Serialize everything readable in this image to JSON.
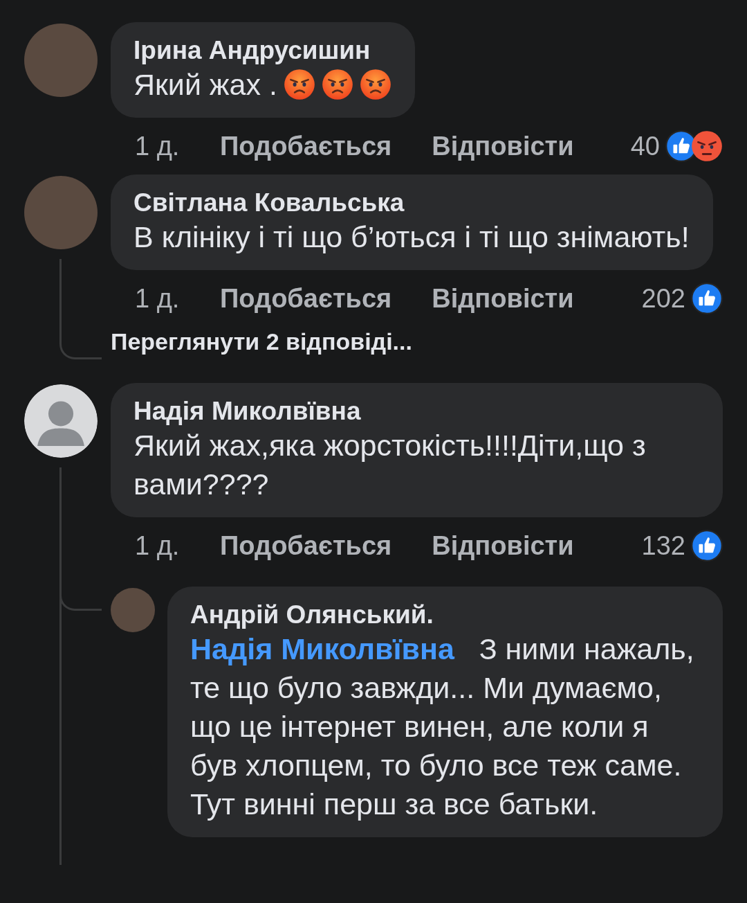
{
  "comments": [
    {
      "author": "Ірина Андрусишин",
      "avatar": {
        "kind": "photo"
      },
      "text": "Який жах .",
      "emoji": [
        {
          "kind": "angry"
        },
        {
          "kind": "angry"
        },
        {
          "kind": "angry"
        }
      ],
      "time": "1 д.",
      "like_label": "Подобається",
      "reply_label": "Відповісти",
      "reaction_count": "40",
      "reactions": [
        {
          "kind": "like"
        },
        {
          "kind": "angry"
        }
      ]
    },
    {
      "author": "Світлана Ковальська",
      "avatar": {
        "kind": "photo"
      },
      "text": "В клініку і ті що б’ються і ті що знімають!",
      "time": "1 д.",
      "like_label": "Подобається",
      "reply_label": "Відповісти",
      "reaction_count": "202",
      "reactions": [
        {
          "kind": "like"
        }
      ],
      "view_replies": "Переглянути 2 відповіді..."
    },
    {
      "author": "Надія Миколвївна",
      "avatar": {
        "kind": "default"
      },
      "text": "Який жах,яка жорстокість!!!!Діти,що з вами????",
      "time": "1 д.",
      "like_label": "Подобається",
      "reply_label": "Відповісти",
      "reaction_count": "132",
      "reactions": [
        {
          "kind": "like"
        }
      ],
      "replies": [
        {
          "author": "Андрій Олянський.",
          "avatar": {
            "kind": "photo"
          },
          "mention": "Надія Миколвївна",
          "text": "З ними нажаль, те що було завжди... Ми думаємо, що це інтернет винен, але коли я був хлопцем, то було все теж саме. Тут винні перш за все батьки."
        }
      ]
    }
  ]
}
